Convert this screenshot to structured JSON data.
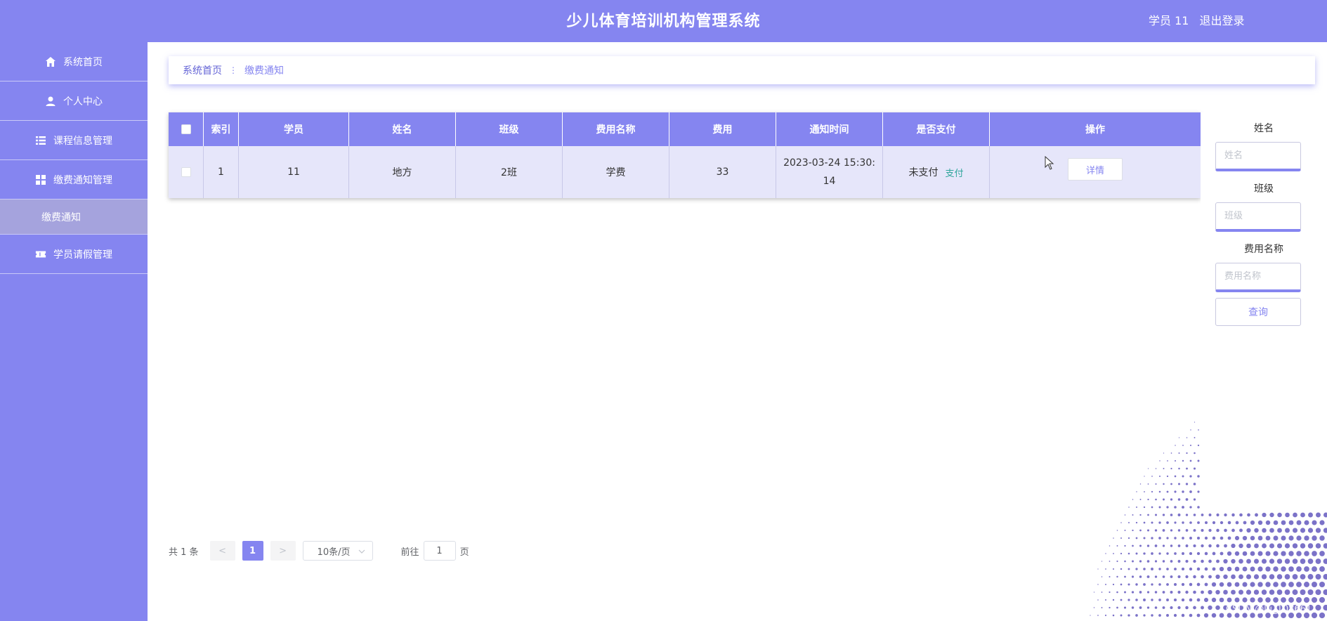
{
  "header": {
    "title": "少儿体育培训机构管理系统",
    "user": "学员 11",
    "logout": "退出登录"
  },
  "sidebar": {
    "items": [
      {
        "label": "系统首页",
        "icon": "home-icon"
      },
      {
        "label": "个人中心",
        "icon": "user-icon"
      },
      {
        "label": "课程信息管理",
        "icon": "list-icon"
      },
      {
        "label": "缴费通知管理",
        "icon": "grid-icon"
      },
      {
        "label": "缴费通知",
        "icon": ""
      },
      {
        "label": "学员请假管理",
        "icon": "ticket-icon"
      }
    ]
  },
  "breadcrumb": {
    "home": "系统首页",
    "separator": "⋮",
    "current": "缴费通知"
  },
  "table": {
    "columns": [
      "索引",
      "学员",
      "姓名",
      "班级",
      "费用名称",
      "费用",
      "通知时间",
      "是否支付",
      "操作"
    ],
    "rows": [
      {
        "index": "1",
        "student": "11",
        "name": "地方",
        "class": "2班",
        "fee_name": "学费",
        "fee": "33",
        "notice_time": "2023-03-24 15:30:14",
        "paid": "未支付",
        "pay_link": "支付",
        "detail": "详情"
      }
    ]
  },
  "search": {
    "name_label": "姓名",
    "name_placeholder": "姓名",
    "class_label": "班级",
    "class_placeholder": "班级",
    "fee_name_label": "费用名称",
    "fee_name_placeholder": "费用名称",
    "query": "查询"
  },
  "pagination": {
    "total": "共 1 条",
    "prev": "<",
    "page": "1",
    "next": ">",
    "page_size": "10条/页",
    "goto_label": "前往",
    "goto_value": "1",
    "page_unit": "页"
  },
  "watermark": "CSDN @lu_108661",
  "colors": {
    "primary": "#8585f0",
    "row_bg": "#e6e6fa",
    "pay_link": "#2ea59b"
  }
}
